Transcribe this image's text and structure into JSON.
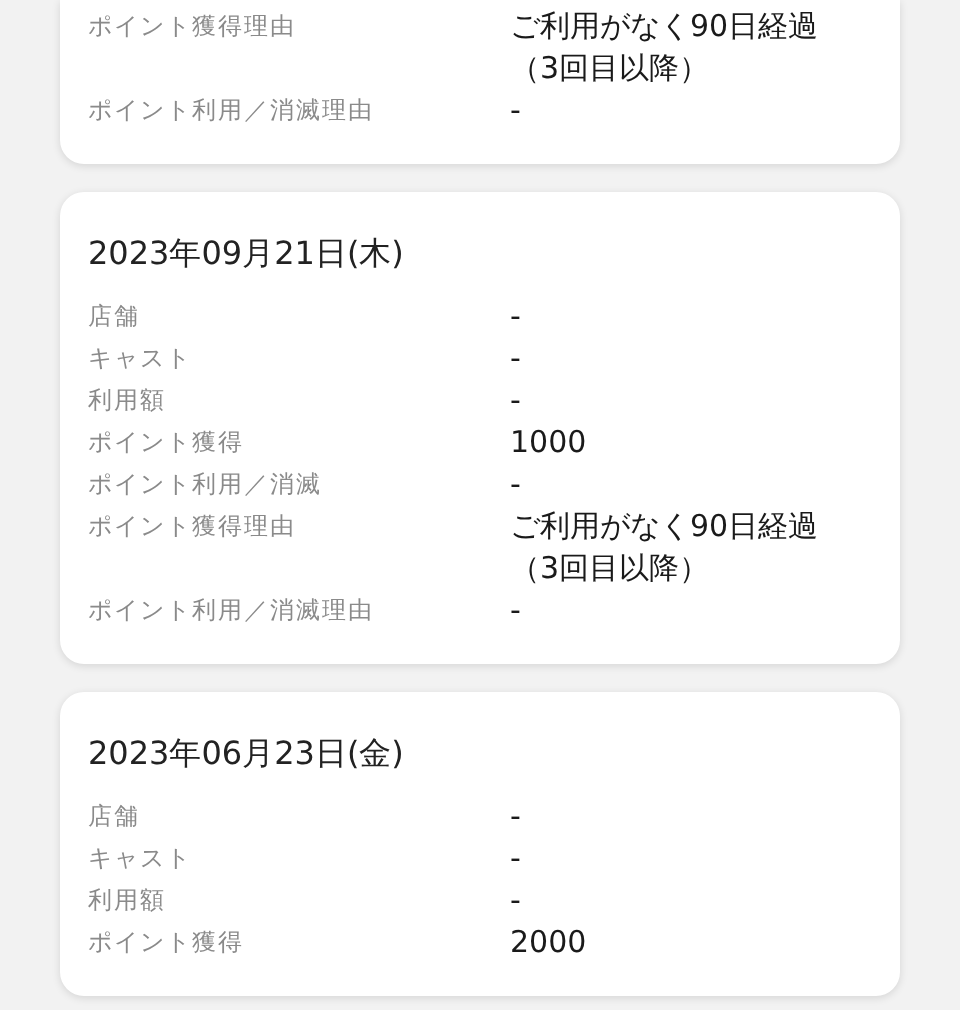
{
  "records": [
    {
      "rows": [
        {
          "label": "ポイント獲得理由",
          "value": "ご利用がなく90日経過（3回目以降）"
        },
        {
          "label": "ポイント利用／消滅理由",
          "value": "-"
        }
      ]
    },
    {
      "date": "2023年09月21日(木)",
      "rows": [
        {
          "label": "店舗",
          "value": "-"
        },
        {
          "label": "キャスト",
          "value": "-"
        },
        {
          "label": "利用額",
          "value": "-"
        },
        {
          "label": "ポイント獲得",
          "value": "1000"
        },
        {
          "label": "ポイント利用／消滅",
          "value": "-"
        },
        {
          "label": "ポイント獲得理由",
          "value": "ご利用がなく90日経過（3回目以降）"
        },
        {
          "label": "ポイント利用／消滅理由",
          "value": "-"
        }
      ]
    },
    {
      "date": "2023年06月23日(金)",
      "rows": [
        {
          "label": "店舗",
          "value": "-"
        },
        {
          "label": "キャスト",
          "value": "-"
        },
        {
          "label": "利用額",
          "value": "-"
        },
        {
          "label": "ポイント獲得",
          "value": "2000"
        }
      ]
    }
  ]
}
